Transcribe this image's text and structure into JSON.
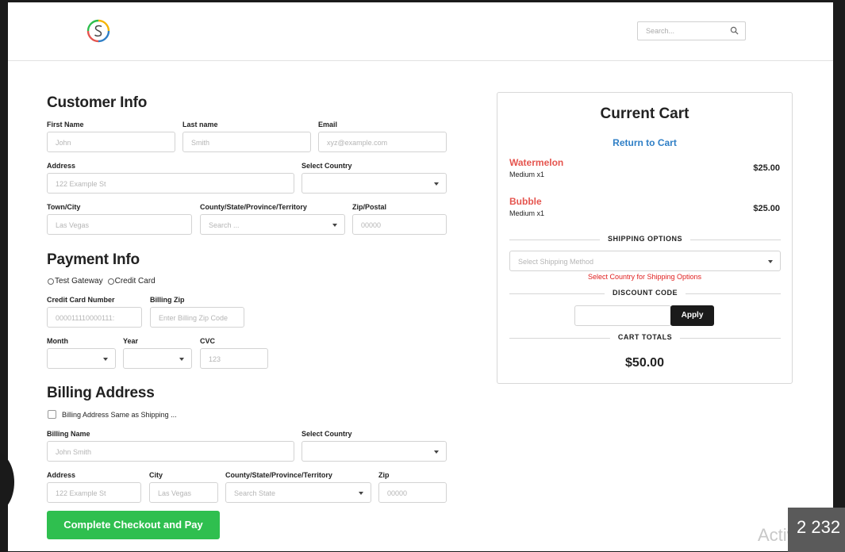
{
  "header": {
    "search_placeholder": "Search..."
  },
  "customer_info": {
    "title": "Customer Info",
    "first_name_label": "First Name",
    "first_name_placeholder": "John",
    "last_name_label": "Last name",
    "last_name_placeholder": "Smith",
    "email_label": "Email",
    "email_placeholder": "xyz@example.com",
    "address_label": "Address",
    "address_placeholder": "122 Example St",
    "country_label": "Select Country",
    "country_value": "",
    "city_label": "Town/City",
    "city_placeholder": "Las Vegas",
    "county_label": "County/State/Province/Territory",
    "county_placeholder": "Search ...",
    "zip_label": "Zip/Postal",
    "zip_placeholder": "00000"
  },
  "payment_info": {
    "title": "Payment Info",
    "options": [
      "Test Gateway",
      "Credit Card"
    ],
    "cc_label": "Credit Card Number",
    "cc_placeholder": "000011110000111:",
    "billing_zip_label": "Billing Zip",
    "billing_zip_placeholder": "Enter Billing Zip Code",
    "month_label": "Month",
    "year_label": "Year",
    "cvc_label": "CVC",
    "cvc_placeholder": "123"
  },
  "billing_address": {
    "title": "Billing Address",
    "same_as_shipping_label": "Billing Address Same as Shipping ...",
    "name_label": "Billing Name",
    "name_placeholder": "John Smith",
    "country_label": "Select Country",
    "address_label": "Address",
    "address_placeholder": "122 Example St",
    "city_label": "City",
    "city_placeholder": "Las Vegas",
    "county_label": "County/State/Province/Territory",
    "county_placeholder": "Search State",
    "zip_label": "Zip",
    "zip_placeholder": "00000"
  },
  "checkout_button": "Complete Checkout and Pay",
  "cart": {
    "title": "Current Cart",
    "return_link": "Return to Cart",
    "items": [
      {
        "name": "Watermelon",
        "variant": "Medium  x1",
        "price": "$25.00"
      },
      {
        "name": "Bubble",
        "variant": "Medium  x1",
        "price": "$25.00"
      }
    ],
    "shipping_heading": "SHIPPING OPTIONS",
    "shipping_placeholder": "Select Shipping Method",
    "shipping_note": "Select Country for Shipping Options",
    "discount_heading": "DISCOUNT CODE",
    "discount_value": "",
    "apply_label": "Apply",
    "totals_heading": "CART TOTALS",
    "total": "$50.00"
  },
  "overlay": {
    "activate_text": "Activate W",
    "badge_text": "2 232"
  },
  "colors": {
    "accent_green": "#2fbf4f",
    "link_blue": "#2f7fc6",
    "item_red": "#e5554f",
    "error_red": "#e02020"
  }
}
